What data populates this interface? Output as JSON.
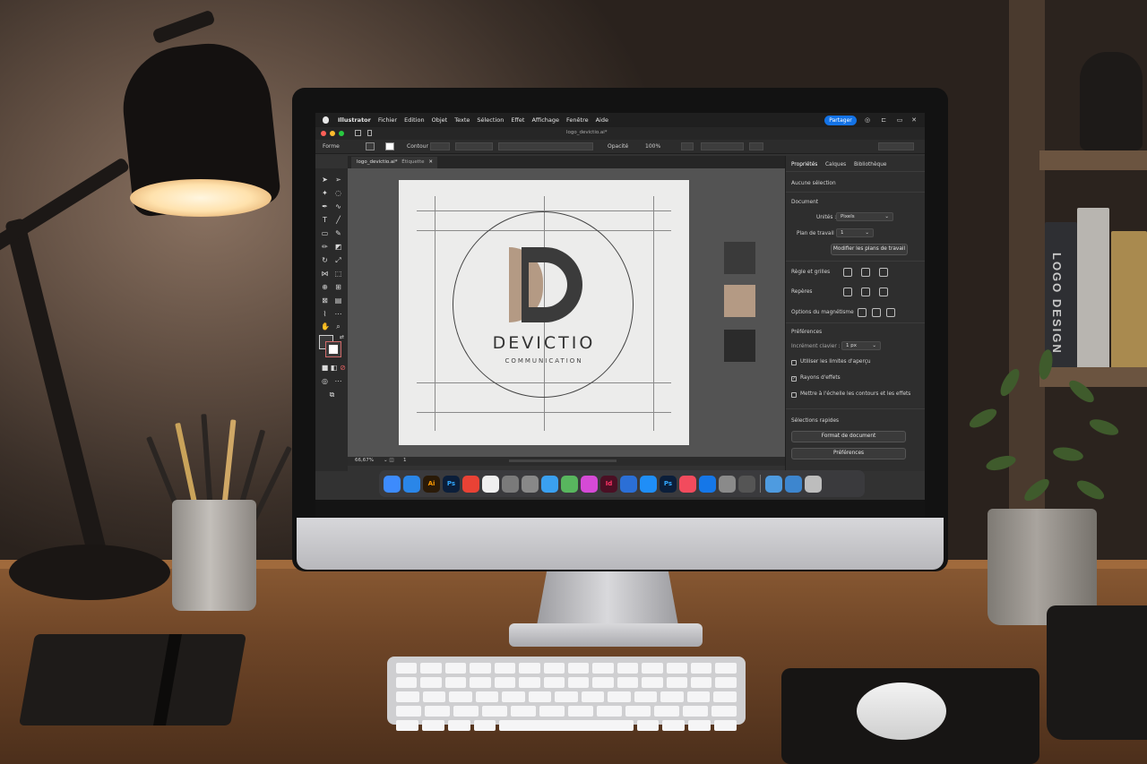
{
  "menubar": {
    "app": "Illustrator",
    "items": [
      "Fichier",
      "Edition",
      "Objet",
      "Texte",
      "Sélection",
      "Effet",
      "Affichage",
      "Fenêtre",
      "Aide"
    ],
    "share_label": "Partager"
  },
  "controlbar": {
    "shape_label": "Forme",
    "stroke_label": "Contour",
    "opacity_label": "Opacité",
    "opacity_value": "100%"
  },
  "tab": {
    "filename": "logo_devictio.ai*",
    "zoom_mode": "Étiquette"
  },
  "artboard": {
    "brand_name": "DEVICTIO",
    "tagline": "COMMUNICATION"
  },
  "swatches": {
    "colors": [
      "#3a3a3a",
      "#b49a84",
      "#2b2b2b"
    ]
  },
  "statusbar": {
    "zoom": "66,67%",
    "page": "1"
  },
  "panel": {
    "tabs": [
      "Propriétés",
      "Calques",
      "Bibliothèque"
    ],
    "no_selection": "Aucune sélection",
    "document_header": "Document",
    "units_label": "Unités :",
    "units_value": "Pixels",
    "artboard_label": "Plan de travail :",
    "artboard_value": "1",
    "edit_artboards_button": "Modifier les plans de travail",
    "rulers_grids": "Règle et grilles",
    "guides": "Repères",
    "snap_options": "Options du magnétisme",
    "preferences_header": "Préférences",
    "keyboard_increment_label": "Incrément clavier :",
    "keyboard_increment_value": "1 px",
    "use_preview_bounds": "Utiliser les limites d'aperçu",
    "scale_corners": "Rayons d'effets",
    "scale_strokes": "Mettre à l'échelle les contours et les effets",
    "quick_actions_header": "Sélections rapides",
    "document_setup_button": "Format de document",
    "preferences_button": "Préférences"
  },
  "dock": {
    "apps": [
      {
        "name": "finder-icon",
        "label": "",
        "color": "#3d8bfd"
      },
      {
        "name": "safari-icon",
        "label": "",
        "color": "#2a86e8"
      },
      {
        "name": "illustrator-icon",
        "label": "Ai",
        "color": "#2a1a08"
      },
      {
        "name": "photoshop-icon",
        "label": "Ps",
        "color": "#0b1e3a"
      },
      {
        "name": "chrome-icon",
        "label": "",
        "color": "#e94235"
      },
      {
        "name": "photos-icon",
        "label": "",
        "color": "#f0f0f0"
      },
      {
        "name": "system-icon",
        "label": "",
        "color": "#7a7a7a"
      },
      {
        "name": "app-store-icon",
        "label": "",
        "color": "#888888"
      },
      {
        "name": "pages-icon",
        "label": "",
        "color": "#3aa0f0"
      },
      {
        "name": "maps-icon",
        "label": "",
        "color": "#58b65e"
      },
      {
        "name": "xd-icon",
        "label": "",
        "color": "#d54ad6"
      },
      {
        "name": "indesign-icon",
        "label": "Id",
        "color": "#4a0f24"
      },
      {
        "name": "acrobat-icon",
        "label": "",
        "color": "#2b6fd6"
      },
      {
        "name": "appstore-icon",
        "label": "",
        "color": "#1f8ef7"
      },
      {
        "name": "photoshop2-icon",
        "label": "Ps",
        "color": "#0b1e3a"
      },
      {
        "name": "music-icon",
        "label": "",
        "color": "#f24b5d"
      },
      {
        "name": "appstore2-icon",
        "label": "",
        "color": "#1577e8"
      },
      {
        "name": "settings-icon",
        "label": "",
        "color": "#8a8a8a"
      },
      {
        "name": "gear-icon",
        "label": "",
        "color": "#555555"
      },
      {
        "name": "folder-icon",
        "label": "",
        "color": "#4e9be0"
      },
      {
        "name": "folder2-icon",
        "label": "",
        "color": "#3d86cf"
      },
      {
        "name": "trash-icon",
        "label": "",
        "color": "#bdbdbd"
      }
    ]
  },
  "shelf": {
    "book_spine": "LOGO DESIGN"
  }
}
